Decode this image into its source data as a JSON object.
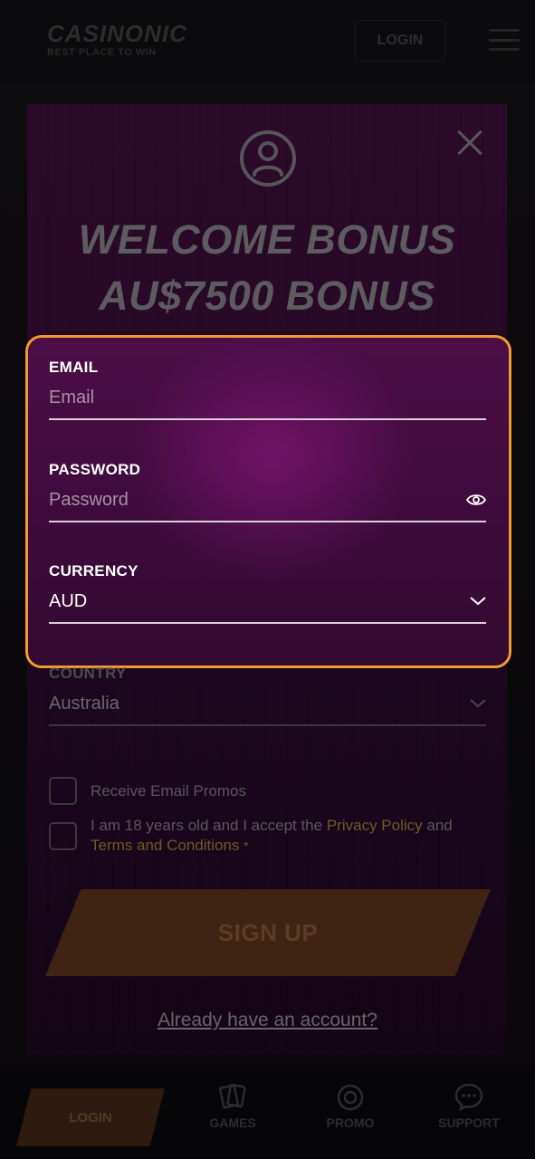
{
  "site": {
    "logo": "CASINONIC",
    "logo_tagline": "BEST PLACE TO WIN",
    "login_label": "LOGIN"
  },
  "modal": {
    "bonus_line1": "WELCOME BONUS",
    "bonus_line2": "AU$7500 BONUS",
    "email": {
      "label": "EMAIL",
      "placeholder": "Email"
    },
    "password": {
      "label": "PASSWORD",
      "placeholder": "Password"
    },
    "currency": {
      "label": "CURRENCY",
      "value": "AUD"
    },
    "country": {
      "label": "COUNTRY",
      "value": "Australia"
    },
    "promo_checkbox": "Receive Email Promos",
    "terms": {
      "prefix": "I am 18 years old and I accept the",
      "privacy": "Privacy Policy",
      "and": "and",
      "terms": "Terms and Conditions",
      "required": "*"
    },
    "signup_label": "SIGN UP",
    "already_link": "Already have an account?"
  },
  "bottom_nav": {
    "login": "LOGIN",
    "games": "GAMES",
    "promo": "PROMO",
    "support": "SUPPORT"
  },
  "colors": {
    "highlight_border": "#f39b2c",
    "modal_bg": "#2c0a2a",
    "accent_link": "#6e5a25"
  },
  "icons": {
    "close": "close-icon",
    "user": "user-icon",
    "eye": "eye-icon",
    "chevron": "chevron-down-icon",
    "games": "cards-icon",
    "promo": "chip-icon",
    "support": "chat-icon"
  }
}
